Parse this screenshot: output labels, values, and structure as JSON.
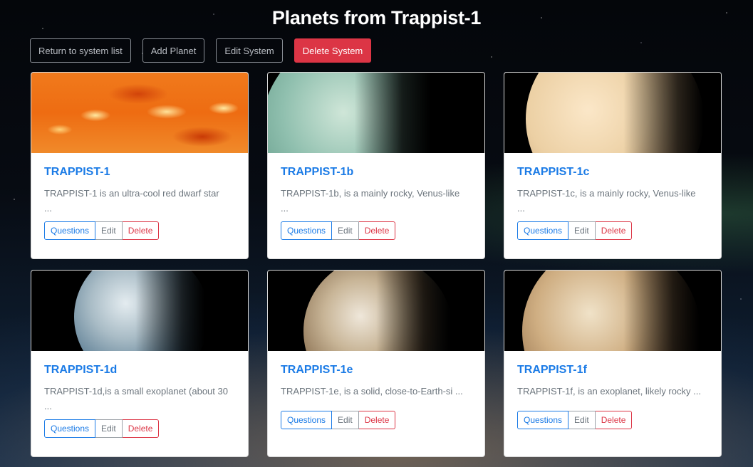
{
  "page": {
    "title": "Planets from Trappist-1"
  },
  "toolbar": {
    "return_label": "Return to system list",
    "add_label": "Add Planet",
    "edit_label": "Edit System",
    "delete_label": "Delete System",
    "delete_color": "#dc3545"
  },
  "card_actions": {
    "questions_label": "Questions",
    "edit_label": "Edit",
    "delete_label": "Delete"
  },
  "planets": [
    {
      "name": "TRAPPIST-1",
      "description": "TRAPPIST-1 is an ultra-cool red dwarf star",
      "ellipsis": "...",
      "image": "sun-surface"
    },
    {
      "name": "TRAPPIST-1b",
      "description": "TRAPPIST-1b, is a mainly rocky, Venus-like",
      "ellipsis": "...",
      "image": "teal-planet"
    },
    {
      "name": "TRAPPIST-1c",
      "description": "TRAPPIST-1c, is a mainly rocky, Venus-like",
      "ellipsis": "...",
      "image": "cream-planet"
    },
    {
      "name": "TRAPPIST-1d",
      "description": "TRAPPIST-1d,is a small exoplanet (about 30",
      "ellipsis": "...",
      "image": "blue-cloudy-planet"
    },
    {
      "name": "TRAPPIST-1e",
      "description": "TRAPPIST-1e, is a solid, close-to-Earth-si ...",
      "ellipsis": "",
      "image": "earthlike-planet"
    },
    {
      "name": "TRAPPIST-1f",
      "description": "TRAPPIST-1f, is an exoplanet, likely rocky ...",
      "ellipsis": "",
      "image": "cracked-planet"
    }
  ],
  "colors": {
    "link_blue": "#1b7be6",
    "danger_red": "#dc3545",
    "muted_text": "#6c757d"
  }
}
